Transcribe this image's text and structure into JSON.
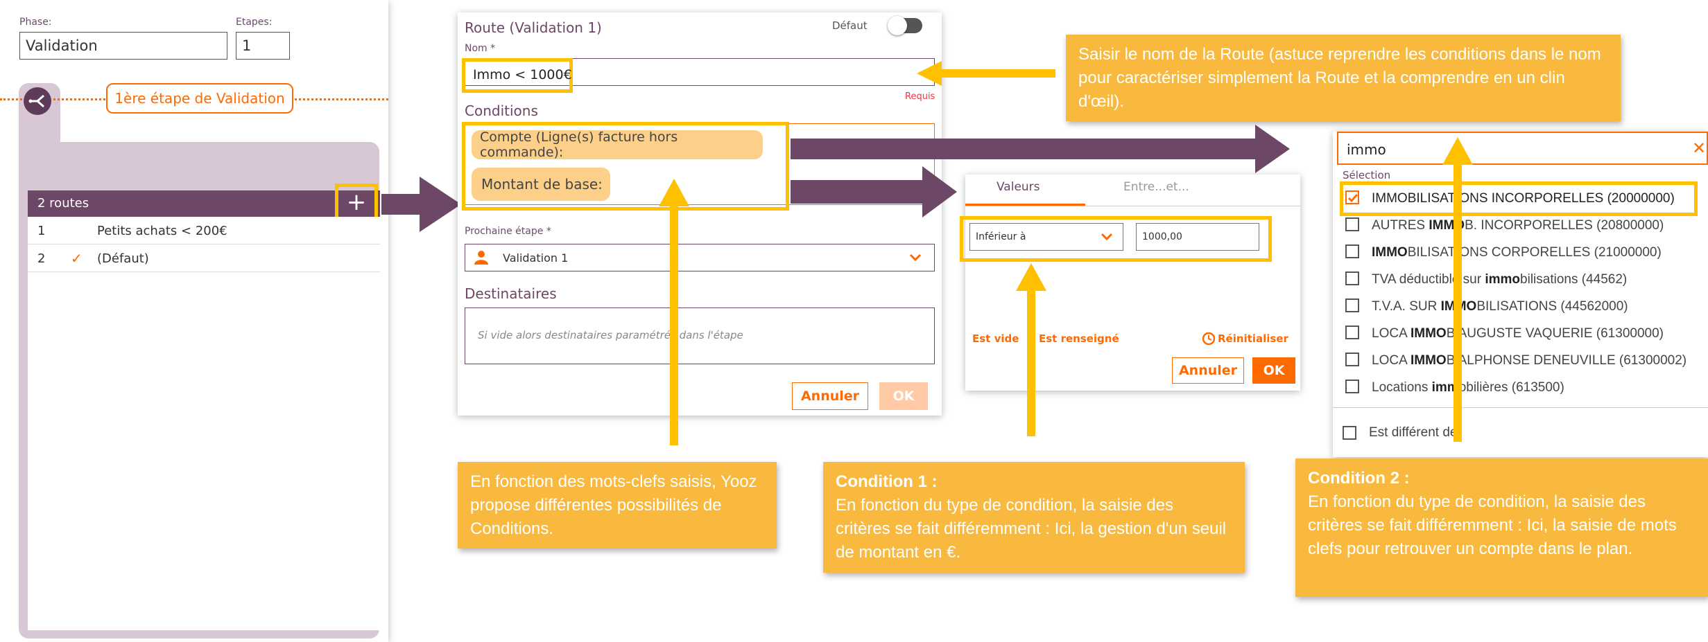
{
  "phase_panel": {
    "phase_label": "Phase:",
    "phase_value": "Validation",
    "etapes_label": "Etapes:",
    "etapes_value": "1",
    "step_badge": "1ère étape de Validation",
    "routes_header": "2 routes",
    "add_symbol": "+",
    "routes": [
      {
        "num": "1",
        "check": "",
        "name": "Petits achats < 200€"
      },
      {
        "num": "2",
        "check": "✓",
        "name": "(Défaut)"
      }
    ]
  },
  "route_dialog": {
    "title": "Route (Validation 1)",
    "default_label": "Défaut",
    "nom_label": "Nom *",
    "nom_value": "Immo < 1000€",
    "requis": "Requis",
    "conditions_label": "Conditions",
    "conditions": [
      "Compte (Ligne(s) facture hors commande):",
      "Montant de base:"
    ],
    "next_step_label": "Prochaine étape *",
    "next_step_value": "Validation 1",
    "destinataires_label": "Destinataires",
    "destinataires_placeholder": "Si vide alors destinataires paramétrés dans l'étape",
    "cancel": "Annuler",
    "ok": "OK"
  },
  "valeurs_dialog": {
    "tab_valeurs": "Valeurs",
    "tab_entre": "Entre...et...",
    "operator": "Inférieur à",
    "amount": "1000,00",
    "est_vide": "Est vide",
    "est_renseigne": "Est renseigné",
    "reinit": "Réinitialiser",
    "cancel": "Annuler",
    "ok": "OK"
  },
  "search_dialog": {
    "query": "immo",
    "selection_label": "Sélection",
    "items": [
      {
        "pre": "",
        "bold": "IMMOBILISATIONS INCORPORELLES (20000000)",
        "post": "",
        "checked": true
      },
      {
        "pre": "AUTRES ",
        "bold": "IMMO",
        "post": "B. INCORPORELLES (20800000)",
        "checked": false
      },
      {
        "pre": "",
        "bold": "IMMO",
        "post": "BILISATIONS CORPORELLES (21000000)",
        "checked": false
      },
      {
        "pre": "TVA déductible sur ",
        "bold": "immo",
        "post": "bilisations (44562)",
        "checked": false
      },
      {
        "pre": "T.V.A. SUR ",
        "bold": "IMMO",
        "post": "BILISATIONS (44562000)",
        "checked": false
      },
      {
        "pre": "LOCA ",
        "bold": "IMMO",
        "post": "B AUGUSTE VAQUERIE (61300000)",
        "checked": false
      },
      {
        "pre": "LOCA ",
        "bold": "IMMO",
        "post": "B ALPHONSE DENEUVILLE (61300002)",
        "checked": false
      },
      {
        "pre": "Locations ",
        "bold": "imm",
        "post": "obilières (613500)",
        "checked": false
      }
    ],
    "different_label": "Est différent de"
  },
  "notes": {
    "route_name": "Saisir le nom de la Route (astuce reprendre les conditions dans le nom pour caractériser simplement la Route et la comprendre en un clin d'œil).",
    "keywords": "En fonction des mots-clefs saisis, Yooz propose différentes possibilités de Conditions.",
    "cond1_title": "Condition 1 :",
    "cond1_text": "En fonction du type de condition, la saisie des critères se fait différemment : Ici,  la gestion d'un seuil de montant en  €.",
    "cond2_title": "Condition 2 :",
    "cond2_text": "En fonction du type de condition, la saisie des critères se fait différemment : Ici, la saisie de mots clefs pour retrouver un compte dans le plan."
  },
  "colors": {
    "purple": "#6d4766",
    "orange": "#ff6a00",
    "note": "#f8b93e",
    "highlight": "#ffc000"
  }
}
